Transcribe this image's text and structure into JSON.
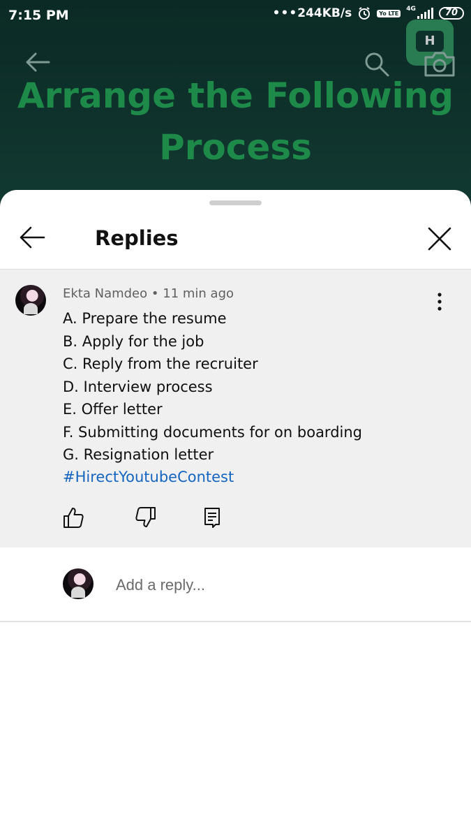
{
  "status_bar": {
    "time": "7:15 PM",
    "network_speed": "244KB/s",
    "volte_badge": "Yo LTE",
    "network_type": "4G",
    "battery": "70"
  },
  "video": {
    "title_line1": "Arrange the Following",
    "title_line2": "Process",
    "logo_letter": "H"
  },
  "sheet": {
    "title": "Replies"
  },
  "comment": {
    "author": "Ekta Namdeo",
    "separator": "•",
    "time_ago": "11 min ago",
    "lines": [
      "A. Prepare the resume",
      "B. Apply for the job",
      "C. Reply from the recruiter",
      "D. Interview process",
      "E. Offer letter",
      "F. Submitting documents for on boarding",
      "G. Resignation letter"
    ],
    "hashtag": "#HirectYoutubeContest"
  },
  "reply": {
    "placeholder": "Add a reply..."
  },
  "colors": {
    "hashtag": "#1565c0",
    "video_title": "#1e8a4a",
    "video_bg": "#0f332c",
    "comment_bg": "#f0f0f0"
  }
}
